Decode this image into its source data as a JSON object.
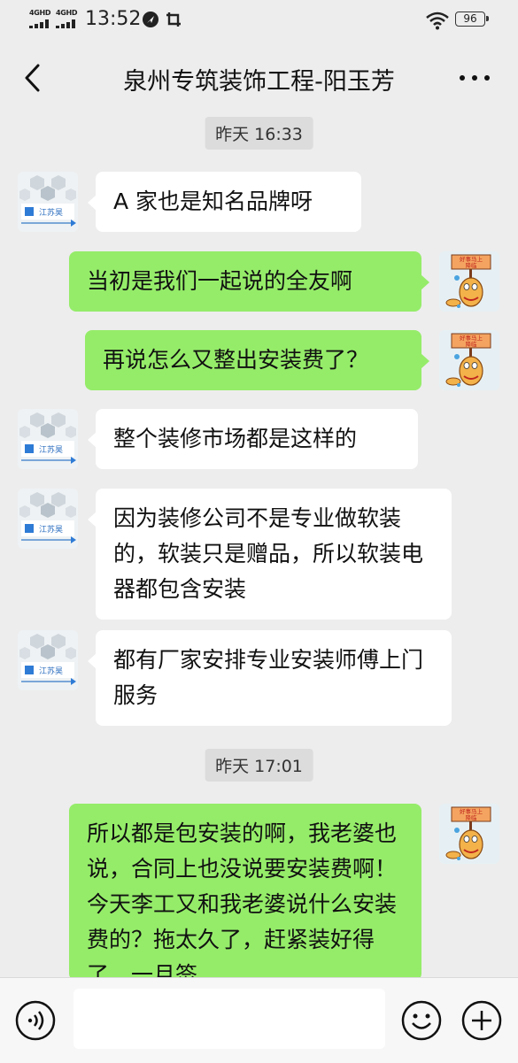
{
  "status_bar": {
    "network_left": "4GHD",
    "network_right": "4GHD",
    "time": "13:52",
    "battery": "96"
  },
  "title_bar": {
    "title": "泉州专筑装饰工程-阳玉芳"
  },
  "chat": {
    "timestamps": [
      "昨天 16:33",
      "昨天 17:01"
    ],
    "messages": [
      {
        "side": "in",
        "text": "A 家也是知名品牌呀"
      },
      {
        "side": "out",
        "text": "当初是我们一起说的全友啊"
      },
      {
        "side": "out",
        "text": "再说怎么又整出安装费了？"
      },
      {
        "side": "in",
        "text": "整个装修市场都是这样的"
      },
      {
        "side": "in",
        "text": "因为装修公司不是专业做软装的，软装只是赠品，所以软装电器都包含安装"
      },
      {
        "side": "in",
        "text": "都有厂家安排专业安装师傅上门服务"
      },
      {
        "side": "out",
        "text": "所以都是包安装的啊，我老婆也说，合同上也没说要安装费啊！今天李工又和我老婆说什么安装费的？拖太久了，赶紧装好得了，一月签"
      }
    ],
    "avatar_in_caption": "江苏昊",
    "avatar_out_sign": "好事马上降临"
  },
  "input_bar": {
    "voice_icon": "voice-icon",
    "emoji_icon": "emoji-icon",
    "plus_icon": "plus-icon"
  }
}
